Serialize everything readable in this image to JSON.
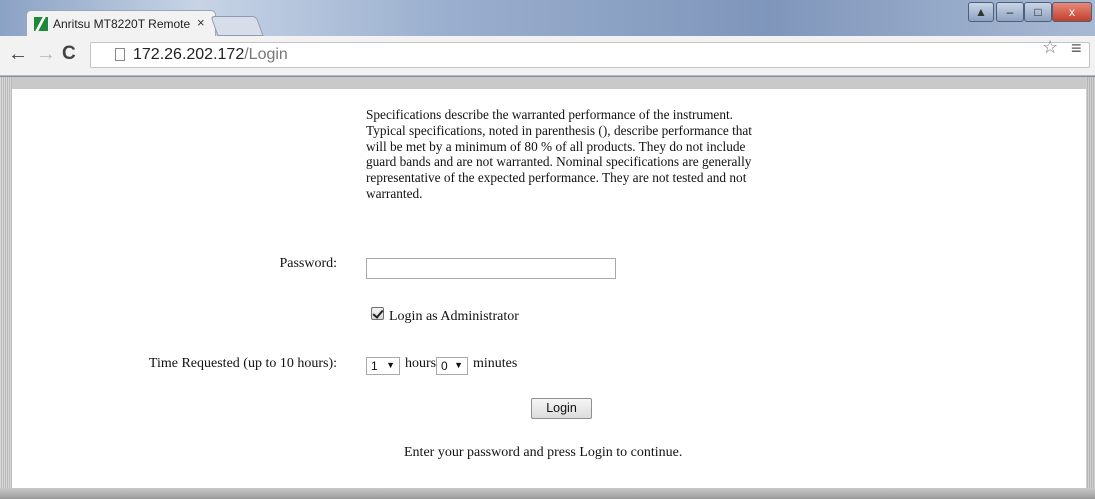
{
  "browser": {
    "tab_title": "Anritsu MT8220T Remote",
    "tab_close": "×",
    "url_host": "172.26.202.172",
    "url_path": "/Login",
    "nav": {
      "back": "←",
      "forward": "→",
      "reload": "C"
    },
    "icons": {
      "favicon": "anritsu-logo",
      "page": "page-icon",
      "star": "☆",
      "menu": "≡"
    }
  },
  "window_controls": {
    "user": "▲",
    "minimize": "–",
    "maximize": "□",
    "close": "x"
  },
  "page": {
    "spec_text": "Specifications describe the warranted performance of the instrument. Typical specifications, noted in parenthesis (), describe performance that will be met by a minimum of 80 % of all products. They do not include guard bands and are not warranted. Nominal specifications are generally representative of the expected performance. They are not tested and not warranted.",
    "password_label": "Password:",
    "password_value": "",
    "admin_checkbox_label": "Login as Administrator",
    "admin_checked": true,
    "time_label": "Time Requested (up to 10 hours):",
    "hours_value": "1",
    "hours_unit": "hours",
    "minutes_value": "0",
    "minutes_unit": "minutes",
    "login_button": "Login",
    "status_message": "Enter your password and press Login to continue."
  },
  "colors": {
    "close_button": "#c2402b",
    "favicon": "#1d8a3a"
  }
}
